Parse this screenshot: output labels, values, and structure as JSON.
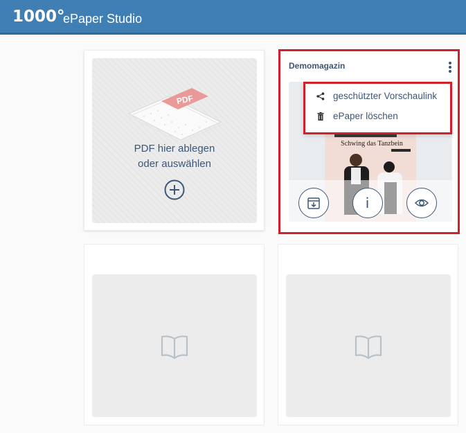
{
  "header": {
    "logo_number": "1000°",
    "app_name": "ePaper Studio"
  },
  "upload_card": {
    "pdf_badge": "PDF",
    "label_line1": "PDF hier ablegen",
    "label_line2": "oder auswählen"
  },
  "epaper_card": {
    "title": "Demomagazin",
    "cover_headline": "Schwing das Tanzbein",
    "menu": {
      "items": [
        {
          "label": "geschützter Vorschaulink",
          "icon": "share-icon"
        },
        {
          "label": "ePaper löschen",
          "icon": "trash-icon"
        }
      ]
    },
    "actions": [
      {
        "icon": "download-icon"
      },
      {
        "icon": "info-icon",
        "label": "i"
      },
      {
        "icon": "eye-icon"
      }
    ]
  },
  "empty_slots": [
    {
      "icon": "book-icon"
    },
    {
      "icon": "book-icon"
    }
  ],
  "colors": {
    "header_bg": "#3f7fb3",
    "text_primary": "#3b5676",
    "highlight": "#d2202a"
  }
}
